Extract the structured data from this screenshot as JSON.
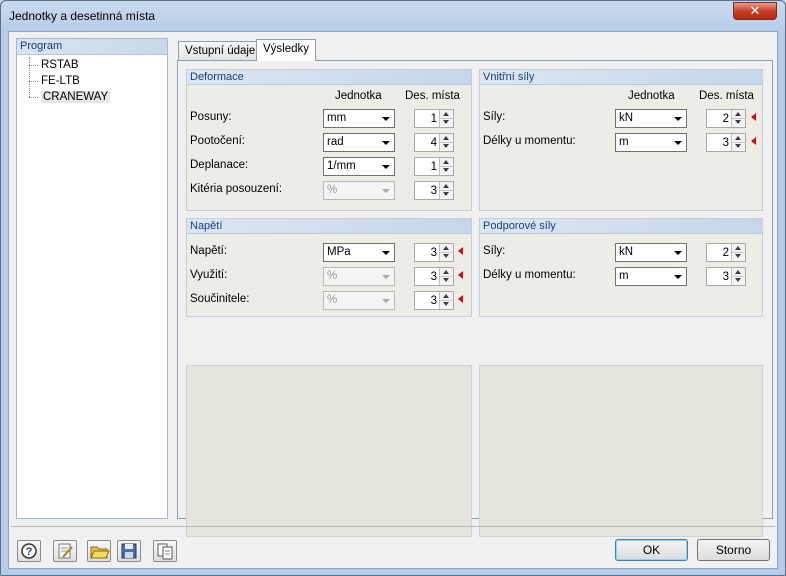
{
  "window": {
    "title": "Jednotky a desetinná místa",
    "close_glyph": "✕"
  },
  "program": {
    "header": "Program",
    "items": [
      "RSTAB",
      "FE-LTB",
      "CRANEWAY"
    ],
    "selected": "CRANEWAY"
  },
  "tabs": [
    "Vstupní údaje",
    "Výsledky"
  ],
  "active_tab": "Výsledky",
  "columns": {
    "unit": "Jednotka",
    "decimals": "Des. místa"
  },
  "deformace": {
    "title": "Deformace",
    "rows": [
      {
        "label": "Posuny:",
        "unit": "mm",
        "decimals": "1",
        "enabled": true,
        "marked": false
      },
      {
        "label": "Pootočení:",
        "unit": "rad",
        "decimals": "4",
        "enabled": true,
        "marked": false
      },
      {
        "label": "Deplanace:",
        "unit": "1/mm",
        "decimals": "1",
        "enabled": true,
        "marked": false
      },
      {
        "label": "Kitéria posouzení:",
        "unit": "%",
        "decimals": "3",
        "enabled": false,
        "marked": false
      }
    ]
  },
  "vnitrni_sily": {
    "title": "Vnitřní síly",
    "rows": [
      {
        "label": "Síly:",
        "unit": "kN",
        "decimals": "2",
        "enabled": true,
        "marked": true
      },
      {
        "label": "Délky u momentu:",
        "unit": "m",
        "decimals": "3",
        "enabled": true,
        "marked": true
      }
    ]
  },
  "napeti": {
    "title": "Napětí",
    "rows": [
      {
        "label": "Napětí:",
        "unit": "MPa",
        "decimals": "3",
        "enabled": true,
        "marked": true
      },
      {
        "label": "Využití:",
        "unit": "%",
        "decimals": "3",
        "enabled": false,
        "marked": true
      },
      {
        "label": "Součinitele:",
        "unit": "%",
        "decimals": "3",
        "enabled": false,
        "marked": true
      }
    ]
  },
  "podporove_sily": {
    "title": "Podporové síly",
    "rows": [
      {
        "label": "Síly:",
        "unit": "kN",
        "decimals": "2",
        "enabled": true,
        "marked": false
      },
      {
        "label": "Délky u momentu:",
        "unit": "m",
        "decimals": "3",
        "enabled": true,
        "marked": false
      }
    ]
  },
  "buttons": {
    "ok": "OK",
    "cancel": "Storno"
  },
  "toolbar_icons": [
    "help-icon",
    "edit-icon",
    "open-folder-icon",
    "save-icon",
    "copy-icon"
  ],
  "colors": {
    "marker": "#c8101a",
    "group_header_text": "#1a3d78",
    "ok_focus": "#3c7fb1"
  }
}
